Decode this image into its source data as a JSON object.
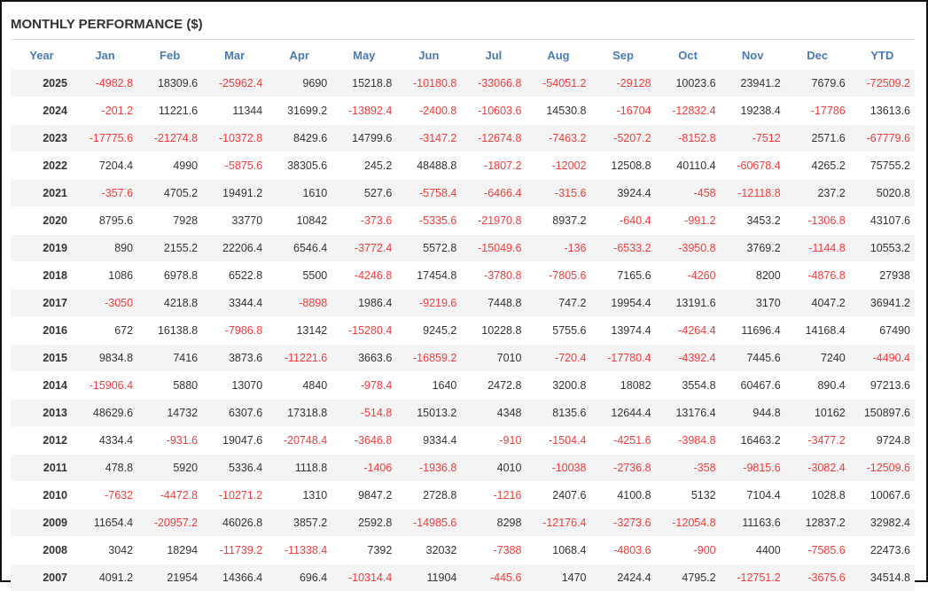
{
  "title": "MONTHLY PERFORMANCE ($)",
  "colors": {
    "header": "#4a7ab0",
    "negative": "#f03c3c",
    "positive": "#333333",
    "stripe": "#f4f4f4"
  },
  "columns": [
    "Year",
    "Jan",
    "Feb",
    "Mar",
    "Apr",
    "May",
    "Jun",
    "Jul",
    "Aug",
    "Sep",
    "Oct",
    "Nov",
    "Dec",
    "YTD"
  ],
  "rows": [
    [
      "2025",
      "-4982.8",
      "18309.6",
      "-25962.4",
      "9690",
      "15218.8",
      "-10180.8",
      "-33066.8",
      "-54051.2",
      "-29128",
      "10023.6",
      "23941.2",
      "7679.6",
      "-72509.2"
    ],
    [
      "2024",
      "-201.2",
      "11221.6",
      "11344",
      "31699.2",
      "-13892.4",
      "-2400.8",
      "-10603.6",
      "14530.8",
      "-16704",
      "-12832.4",
      "19238.4",
      "-17786",
      "13613.6"
    ],
    [
      "2023",
      "-17775.6",
      "-21274.8",
      "-10372.8",
      "8429.6",
      "14799.6",
      "-3147.2",
      "-12674.8",
      "-7463.2",
      "-5207.2",
      "-8152.8",
      "-7512",
      "2571.6",
      "-67779.6"
    ],
    [
      "2022",
      "7204.4",
      "4990",
      "-5875.6",
      "38305.6",
      "245.2",
      "48488.8",
      "-1807.2",
      "-12002",
      "12508.8",
      "40110.4",
      "-60678.4",
      "4265.2",
      "75755.2"
    ],
    [
      "2021",
      "-357.6",
      "4705.2",
      "19491.2",
      "1610",
      "527.6",
      "-5758.4",
      "-6466.4",
      "-315.6",
      "3924.4",
      "-458",
      "-12118.8",
      "237.2",
      "5020.8"
    ],
    [
      "2020",
      "8795.6",
      "7928",
      "33770",
      "10842",
      "-373.6",
      "-5335.6",
      "-21970.8",
      "8937.2",
      "-640.4",
      "-991.2",
      "3453.2",
      "-1306.8",
      "43107.6"
    ],
    [
      "2019",
      "890",
      "2155.2",
      "22206.4",
      "6546.4",
      "-3772.4",
      "5572.8",
      "-15049.6",
      "-136",
      "-6533.2",
      "-3950.8",
      "3769.2",
      "-1144.8",
      "10553.2"
    ],
    [
      "2018",
      "1086",
      "6978.8",
      "6522.8",
      "5500",
      "-4246.8",
      "17454.8",
      "-3780.8",
      "-7805.6",
      "7165.6",
      "-4260",
      "8200",
      "-4876.8",
      "27938"
    ],
    [
      "2017",
      "-3050",
      "4218.8",
      "3344.4",
      "-8898",
      "1986.4",
      "-9219.6",
      "7448.8",
      "747.2",
      "19954.4",
      "13191.6",
      "3170",
      "4047.2",
      "36941.2"
    ],
    [
      "2016",
      "672",
      "16138.8",
      "-7986.8",
      "13142",
      "-15280.4",
      "9245.2",
      "10228.8",
      "5755.6",
      "13974.4",
      "-4264.4",
      "11696.4",
      "14168.4",
      "67490"
    ],
    [
      "2015",
      "9834.8",
      "7416",
      "3873.6",
      "-11221.6",
      "3663.6",
      "-16859.2",
      "7010",
      "-720.4",
      "-17780.4",
      "-4392.4",
      "7445.6",
      "7240",
      "-4490.4"
    ],
    [
      "2014",
      "-15906.4",
      "5880",
      "13070",
      "4840",
      "-978.4",
      "1640",
      "2472.8",
      "3200.8",
      "18082",
      "3554.8",
      "60467.6",
      "890.4",
      "97213.6"
    ],
    [
      "2013",
      "48629.6",
      "14732",
      "6307.6",
      "17318.8",
      "-514.8",
      "15013.2",
      "4348",
      "8135.6",
      "12644.4",
      "13176.4",
      "944.8",
      "10162",
      "150897.6"
    ],
    [
      "2012",
      "4334.4",
      "-931.6",
      "19047.6",
      "-20748.4",
      "-3646.8",
      "9334.4",
      "-910",
      "-1504.4",
      "-4251.6",
      "-3984.8",
      "16463.2",
      "-3477.2",
      "9724.8"
    ],
    [
      "2011",
      "478.8",
      "5920",
      "5336.4",
      "1118.8",
      "-1406",
      "-1936.8",
      "4010",
      "-10038",
      "-2736.8",
      "-358",
      "-9815.6",
      "-3082.4",
      "-12509.6"
    ],
    [
      "2010",
      "-7632",
      "-4472.8",
      "-10271.2",
      "1310",
      "9847.2",
      "2728.8",
      "-1216",
      "2407.6",
      "4100.8",
      "5132",
      "7104.4",
      "1028.8",
      "10067.6"
    ],
    [
      "2009",
      "11654.4",
      "-20957.2",
      "46026.8",
      "3857.2",
      "2592.8",
      "-14985.6",
      "8298",
      "-12176.4",
      "-3273.6",
      "-12054.8",
      "11163.6",
      "12837.2",
      "32982.4"
    ],
    [
      "2008",
      "3042",
      "18294",
      "-11739.2",
      "-11338.4",
      "7392",
      "32032",
      "-7388",
      "1068.4",
      "-4803.6",
      "-900",
      "4400",
      "-7585.6",
      "22473.6"
    ],
    [
      "2007",
      "4091.2",
      "21954",
      "14366.4",
      "696.4",
      "-10314.4",
      "11904",
      "-445.6",
      "1470",
      "2424.4",
      "4795.2",
      "-12751.2",
      "-3675.6",
      "34514.8"
    ]
  ]
}
